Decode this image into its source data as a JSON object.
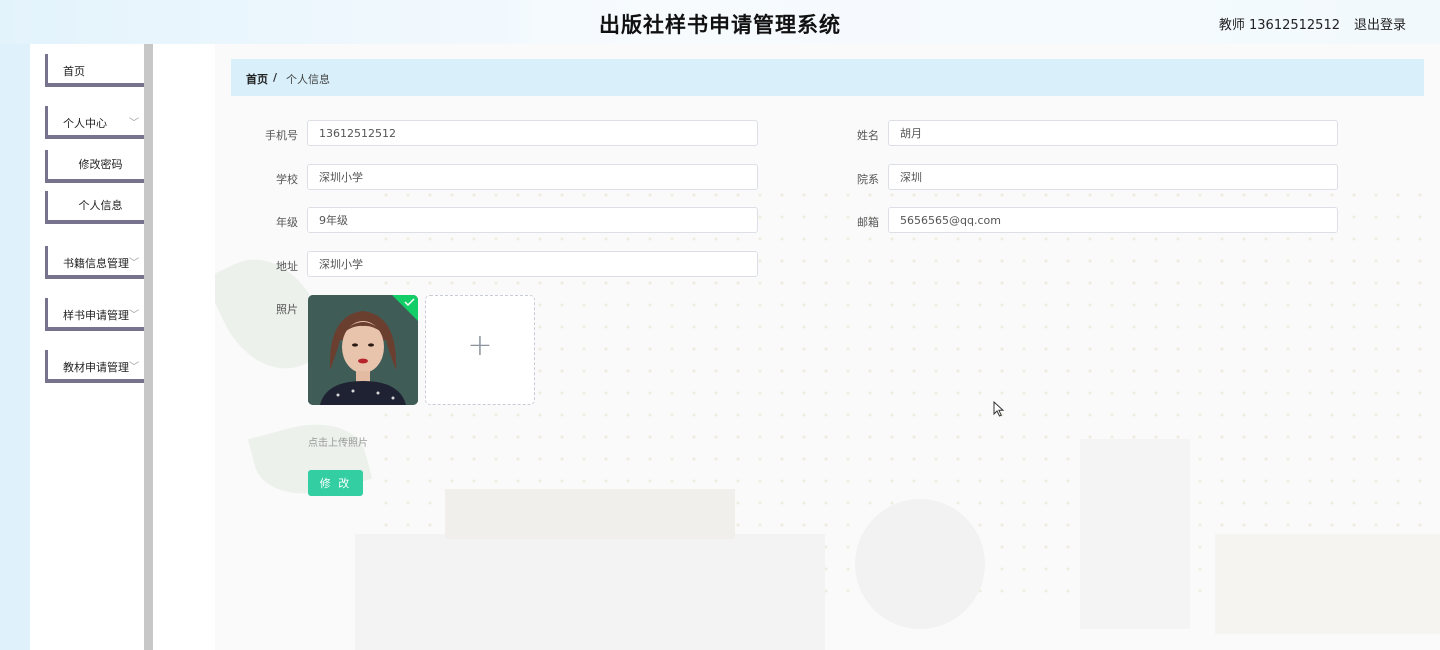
{
  "header": {
    "title": "出版社样书申请管理系统",
    "user_label": "教师 13612512512",
    "logout_label": "退出登录"
  },
  "sidebar": {
    "items": [
      {
        "label": "首页",
        "has_children": false
      },
      {
        "label": "个人中心",
        "has_children": true,
        "children": [
          "修改密码",
          "个人信息"
        ]
      },
      {
        "label": "书籍信息管理",
        "has_children": true
      },
      {
        "label": "样书申请管理",
        "has_children": true
      },
      {
        "label": "教材申请管理",
        "has_children": true
      }
    ]
  },
  "breadcrumb": {
    "home": "首页",
    "separator": "/",
    "current": "个人信息"
  },
  "form": {
    "phone": {
      "label": "手机号",
      "value": "13612512512"
    },
    "name": {
      "label": "姓名",
      "value": "胡月"
    },
    "school": {
      "label": "学校",
      "value": "深圳小学"
    },
    "department": {
      "label": "院系",
      "value": "深圳"
    },
    "grade": {
      "label": "年级",
      "value": "9年级"
    },
    "email": {
      "label": "邮箱",
      "value": "5656565@qq.com"
    },
    "address": {
      "label": "地址",
      "value": "深圳小学"
    },
    "photo": {
      "label": "照片",
      "upload_hint": "点击上传照片",
      "uploaded": true
    },
    "submit_label": "修 改"
  },
  "colors": {
    "header_bg": "#e3f3fc",
    "breadcrumb_bg": "#d9f0fb",
    "menu_border": "#77738e",
    "button_bg": "#33cfa2",
    "success_badge": "#13ce66"
  },
  "icons": [
    "chevron-down-icon",
    "check-icon",
    "plus-icon",
    "cursor-icon"
  ]
}
